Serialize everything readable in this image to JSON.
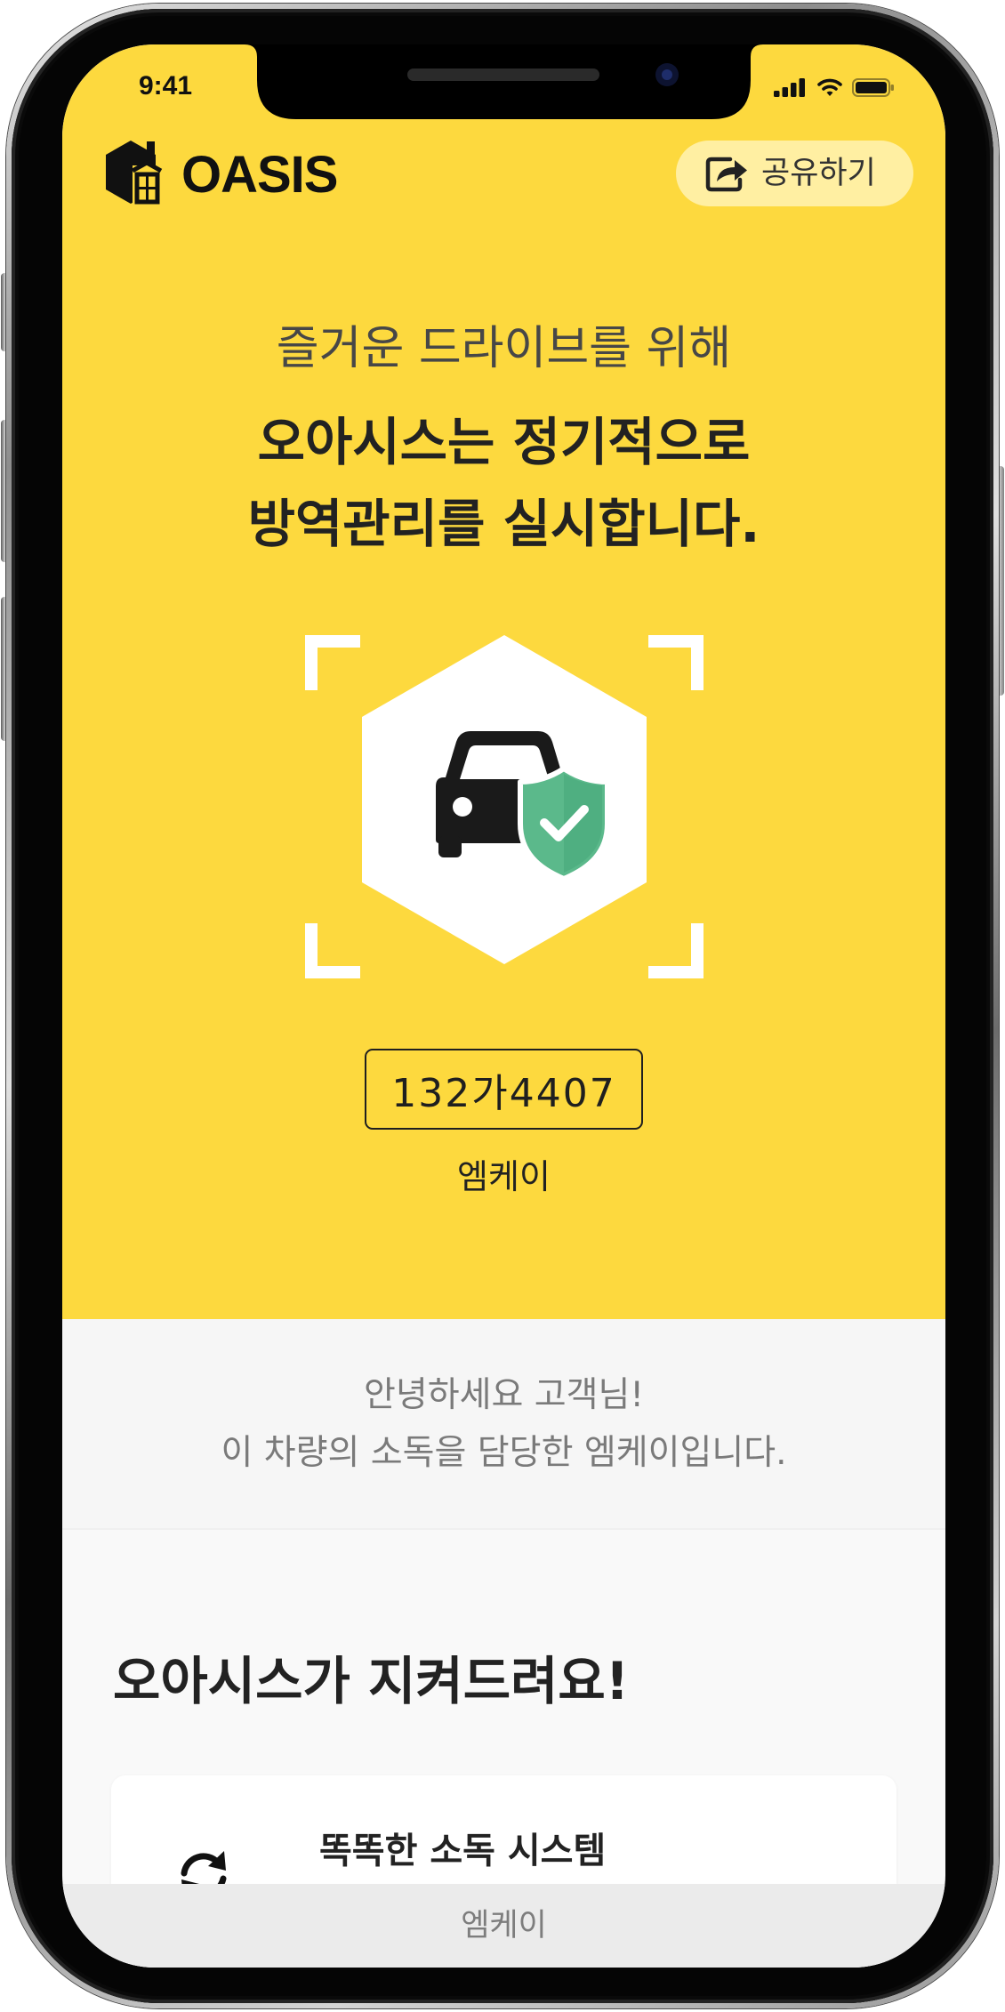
{
  "status_bar": {
    "time": "9:41",
    "icons": [
      "cellular-signal-icon",
      "wifi-icon",
      "battery-icon"
    ]
  },
  "header": {
    "logo_icon": "oasis-logo-icon",
    "brand": "OASIS",
    "share": {
      "icon": "share-icon",
      "label": "공유하기"
    }
  },
  "hero": {
    "subtitle": "즐거운 드라이브를 위해",
    "title_lines": [
      "오아시스는 정기적으로",
      "방역관리를 실시합니다."
    ],
    "emblem_icons": [
      "car-icon",
      "shield-check-icon"
    ],
    "plate_number": "132가4407",
    "company": "엠케이"
  },
  "greeting": {
    "lines": [
      "안녕하세요 고객님!",
      "이 차량의 소독을 담당한 엠케이입니다."
    ]
  },
  "features": {
    "heading": "오아시스가 지켜드려요!",
    "items": [
      {
        "icon": "refresh-icon",
        "title": "똑똑한 소독 시스템"
      }
    ]
  },
  "footer": {
    "label": "엠케이"
  },
  "colors": {
    "brand_yellow": "#FDD93E",
    "share_pill": "#FFEFA2",
    "shield_green": "#5BB98B",
    "text_dark": "#222222",
    "text_muted": "#7A7A7A",
    "section_gray": "#F6F6F6",
    "footer_gray": "#EBEBEB"
  }
}
